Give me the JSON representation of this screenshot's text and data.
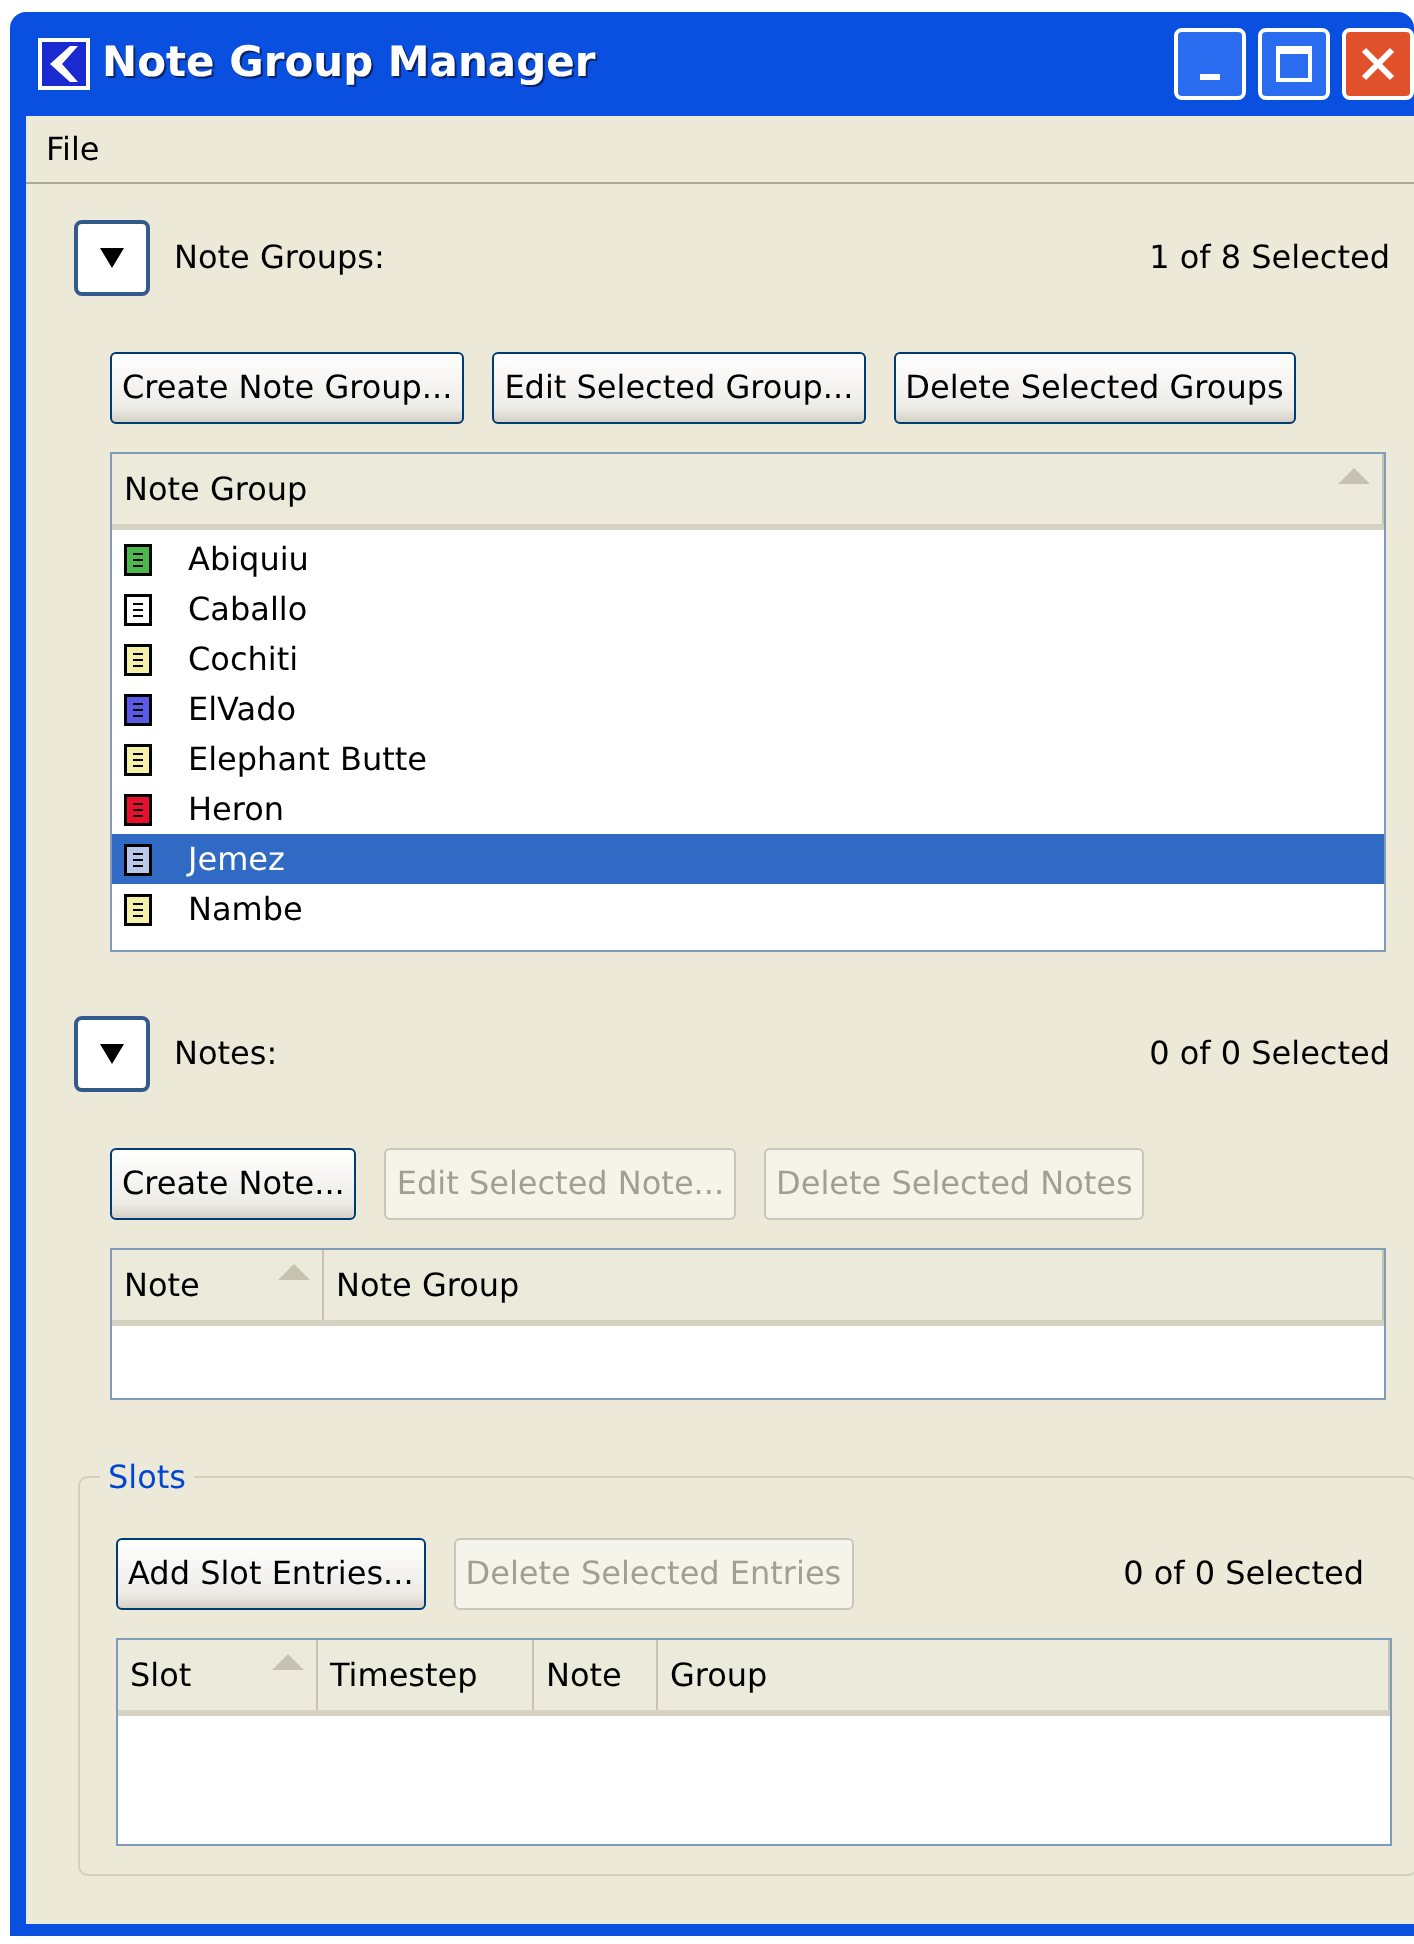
{
  "window": {
    "title": "Note Group Manager"
  },
  "menu": [
    "File"
  ],
  "note_groups": {
    "label": "Note Groups:",
    "expanded": true,
    "count": "1 of 8 Selected",
    "buttons": [
      {
        "label": "Create Note Group...",
        "disabled": false
      },
      {
        "label": "Edit Selected Group...",
        "disabled": false
      },
      {
        "label": "Delete Selected Groups",
        "disabled": false
      }
    ],
    "columns": [
      {
        "label": "Note Group",
        "sorted": true
      }
    ],
    "rows": [
      {
        "name": "Abiquiu",
        "color": "#4cb84c",
        "selected": false
      },
      {
        "name": "Caballo",
        "color": "#ffffff",
        "selected": false
      },
      {
        "name": "Cochiti",
        "color": "#f5f0a8",
        "selected": false
      },
      {
        "name": "ElVado",
        "color": "#5a5ae6",
        "selected": false
      },
      {
        "name": "Elephant Butte",
        "color": "#f5f0a8",
        "selected": false
      },
      {
        "name": "Heron",
        "color": "#e8102c",
        "selected": false
      },
      {
        "name": "Jemez",
        "color": "#b8c8e8",
        "selected": true
      },
      {
        "name": "Nambe",
        "color": "#f5f0a8",
        "selected": false
      }
    ]
  },
  "notes": {
    "label": "Notes:",
    "expanded": true,
    "count": "0 of 0 Selected",
    "buttons": [
      {
        "label": "Create Note...",
        "disabled": false
      },
      {
        "label": "Edit Selected Note...",
        "disabled": true
      },
      {
        "label": "Delete Selected Notes",
        "disabled": true
      }
    ],
    "columns": [
      {
        "label": "Note",
        "sorted": true
      },
      {
        "label": "Note Group",
        "sorted": false
      }
    ]
  },
  "slots": {
    "title": "Slots",
    "count": "0 of 0 Selected",
    "buttons": [
      {
        "label": "Add Slot Entries...",
        "disabled": false
      },
      {
        "label": "Delete Selected Entries",
        "disabled": true
      }
    ],
    "columns": [
      {
        "label": "Slot",
        "sorted": true
      },
      {
        "label": "Timestep",
        "sorted": false
      },
      {
        "label": "Note",
        "sorted": false
      },
      {
        "label": "Group",
        "sorted": false
      }
    ]
  }
}
